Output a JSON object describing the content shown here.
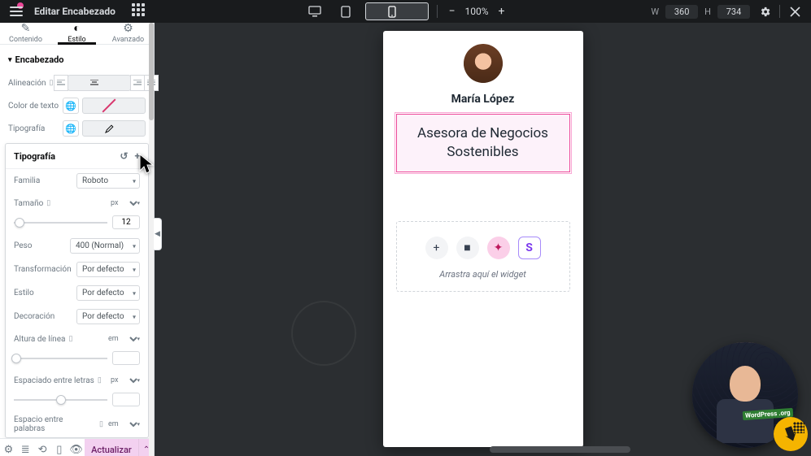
{
  "top": {
    "title": "Editar Encabezado",
    "zoom": "100%",
    "w_label": "W",
    "w_val": "360",
    "h_label": "H",
    "h_val": "734"
  },
  "tabs": {
    "content": "Contenido",
    "style": "Estilo",
    "advanced": "Avanzado"
  },
  "section": {
    "title": "Encabezado"
  },
  "controls": {
    "align": "Alineación",
    "text_color": "Color de texto",
    "typo": "Tipografía"
  },
  "typo": {
    "title": "Tipografía",
    "family_l": "Familia",
    "family_v": "Roboto",
    "size_l": "Tamaño",
    "size_u": "px",
    "size_v": "12",
    "weight_l": "Peso",
    "weight_v": "400 (Normal)",
    "transform_l": "Transformación",
    "transform_v": "Por defecto",
    "fstyle_l": "Estilo",
    "fstyle_v": "Por defecto",
    "decor_l": "Decoración",
    "decor_v": "Por defecto",
    "lheight_l": "Altura de línea",
    "lheight_u": "em",
    "lspace_l": "Espaciado entre letras",
    "lspace_u": "px",
    "wspace_l": "Espacio entre palabras",
    "wspace_u": "em"
  },
  "footer": {
    "publish": "Actualizar"
  },
  "preview": {
    "name": "María López",
    "heading": "Asesora de Negocios Sostenibles",
    "drop_hint": "Arrastra aquí el widget"
  },
  "webcam": {
    "badge": "WordPress .org"
  }
}
